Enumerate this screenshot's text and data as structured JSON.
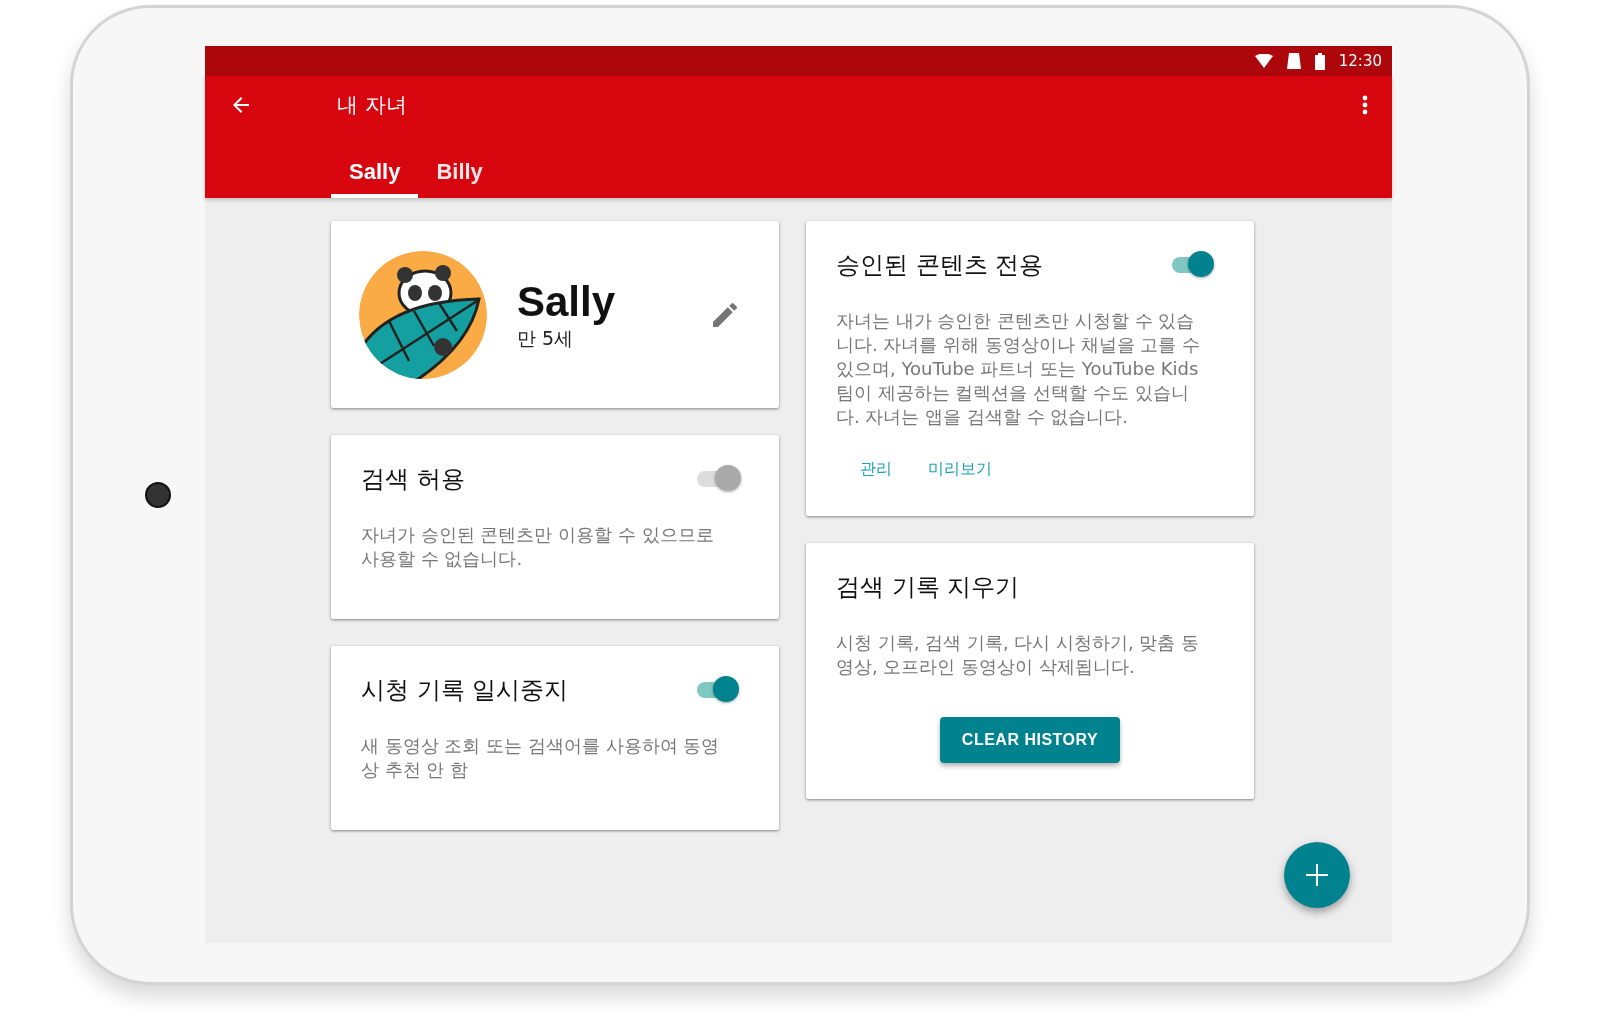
{
  "status_bar": {
    "time": "12:30"
  },
  "app_bar": {
    "title": "내 자녀"
  },
  "tabs": [
    {
      "label": "Sally",
      "selected": true
    },
    {
      "label": "Billy",
      "selected": false
    }
  ],
  "left_cards": [
    {
      "kind": "profile",
      "name": "Sally",
      "age": "만 5세"
    },
    {
      "kind": "toggle",
      "title": "검색 허용",
      "description": "자녀가 승인된 콘텐츠만 이용할 수 있으므로 사용할 수 없습니다.",
      "on": false
    },
    {
      "kind": "toggle",
      "title": "시청 기록 일시중지",
      "description": "새 동영상 조회 또는 검색어를 사용하여 동영상 추천 안 함",
      "on": true
    }
  ],
  "right_cards": [
    {
      "kind": "toggle",
      "title": "승인된 콘텐츠 전용",
      "description": "자녀는 내가 승인한 콘텐츠만 시청할 수 있습니다. 자녀를 위해 동영상이나 채널을 고를 수 있으며, YouTube 파트너 또는 YouTube Kids팀이 제공하는 컬렉션을 선택할 수도 있습니다. 자녀는 앱을 검색할 수 없습니다.",
      "on": true,
      "links": [
        "관리",
        "미리보기"
      ]
    },
    {
      "kind": "action",
      "title": "검색 기록 지우기",
      "description": "시청 기록, 검색 기록, 다시 시청하기, 맞춤 동영상, 오프라인 동영상이 삭제됩니다.",
      "button": "CLEAR HISTORY"
    }
  ]
}
